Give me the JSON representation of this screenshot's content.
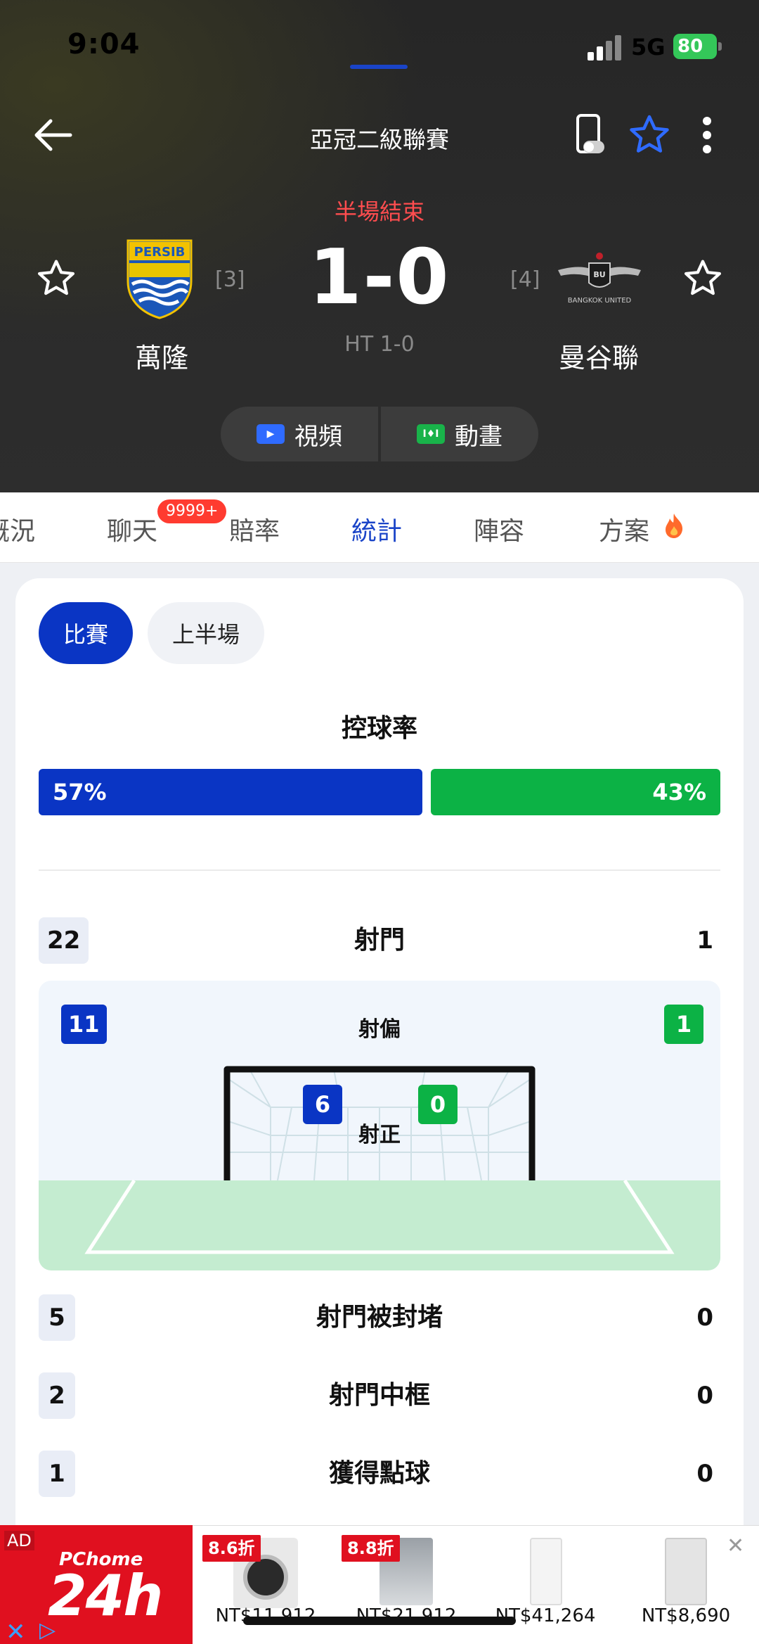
{
  "status_bar": {
    "time": "9:04",
    "network": "5G",
    "battery": "80"
  },
  "header": {
    "league": "亞冠二級聯賽",
    "match_status": "半場結束",
    "score": "1-0",
    "ht_score": "HT 1-0",
    "home": {
      "name": "萬隆",
      "rank": "[3]",
      "logo_text": "PERSIB"
    },
    "away": {
      "name": "曼谷聯",
      "rank": "[4]",
      "logo_text": "BANGKOK UNITED"
    },
    "media": {
      "video": "視頻",
      "animation": "動畫"
    },
    "colors": {
      "status": "#ff4d4f",
      "favorite": "#2f6bff"
    }
  },
  "tabs": {
    "items": [
      "概況",
      "聊天",
      "賠率",
      "統計",
      "陣容",
      "方案"
    ],
    "active": "統計",
    "chat_badge": "9999+"
  },
  "stats": {
    "periods": [
      "比賽",
      "上半場"
    ],
    "active_period": "比賽",
    "possession": {
      "title": "控球率",
      "home": "57%",
      "away": "43%",
      "home_value": 57,
      "away_value": 43
    },
    "shots": {
      "label": "射門",
      "home": "22",
      "away": "1"
    },
    "off_target": {
      "label": "射偏",
      "home": "11",
      "away": "1"
    },
    "on_target": {
      "label": "射正",
      "home": "6",
      "away": "0"
    },
    "blocked": {
      "label": "射門被封堵",
      "home": "5",
      "away": "0"
    },
    "woodwork": {
      "label": "射門中框",
      "home": "2",
      "away": "0"
    },
    "penalties": {
      "label": "獲得點球",
      "home": "1",
      "away": "0"
    },
    "colors": {
      "home": "#0a35c4",
      "away": "#0cb245"
    }
  },
  "ad": {
    "tag": "AD",
    "brand_top": "PChome",
    "brand_main": "24h",
    "products": [
      {
        "discount": "8.6折",
        "price": "NT$11,912"
      },
      {
        "discount": "8.8折",
        "price": "NT$21,912"
      },
      {
        "discount": "",
        "price": "NT$41,264"
      },
      {
        "discount": "",
        "price": "NT$8,690"
      }
    ]
  }
}
